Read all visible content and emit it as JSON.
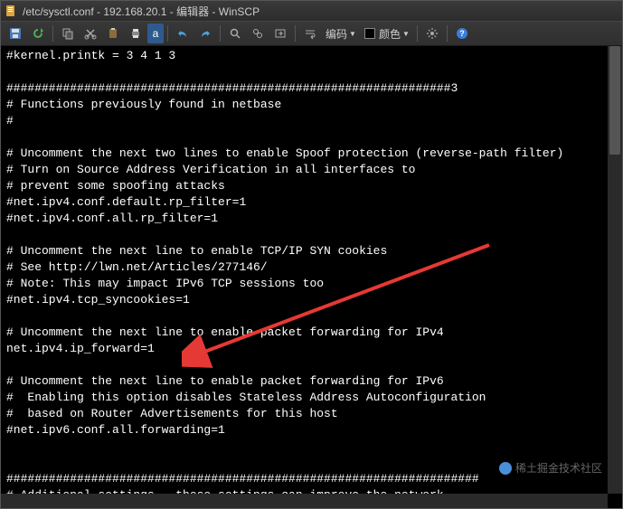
{
  "window": {
    "title": "/etc/sysctl.conf - 192.168.20.1 - 编辑器 - WinSCP"
  },
  "toolbar": {
    "encoding_label": "编码",
    "color_label": "颜色"
  },
  "editor": {
    "lines": [
      "#kernel.printk = 3 4 1 3",
      "",
      "###############################################################3",
      "# Functions previously found in netbase",
      "#",
      "",
      "# Uncomment the next two lines to enable Spoof protection (reverse-path filter)",
      "# Turn on Source Address Verification in all interfaces to",
      "# prevent some spoofing attacks",
      "#net.ipv4.conf.default.rp_filter=1",
      "#net.ipv4.conf.all.rp_filter=1",
      "",
      "# Uncomment the next line to enable TCP/IP SYN cookies",
      "# See http://lwn.net/Articles/277146/",
      "# Note: This may impact IPv6 TCP sessions too",
      "#net.ipv4.tcp_syncookies=1",
      "",
      "# Uncomment the next line to enable packet forwarding for IPv4",
      "net.ipv4.ip_forward=1",
      "",
      "# Uncomment the next line to enable packet forwarding for IPv6",
      "#  Enabling this option disables Stateless Address Autoconfiguration",
      "#  based on Router Advertisements for this host",
      "#net.ipv6.conf.all.forwarding=1",
      "",
      "",
      "###################################################################",
      "# Additional settings - these settings can improve the network"
    ]
  },
  "watermark": {
    "text": "稀土掘金技术社区"
  }
}
